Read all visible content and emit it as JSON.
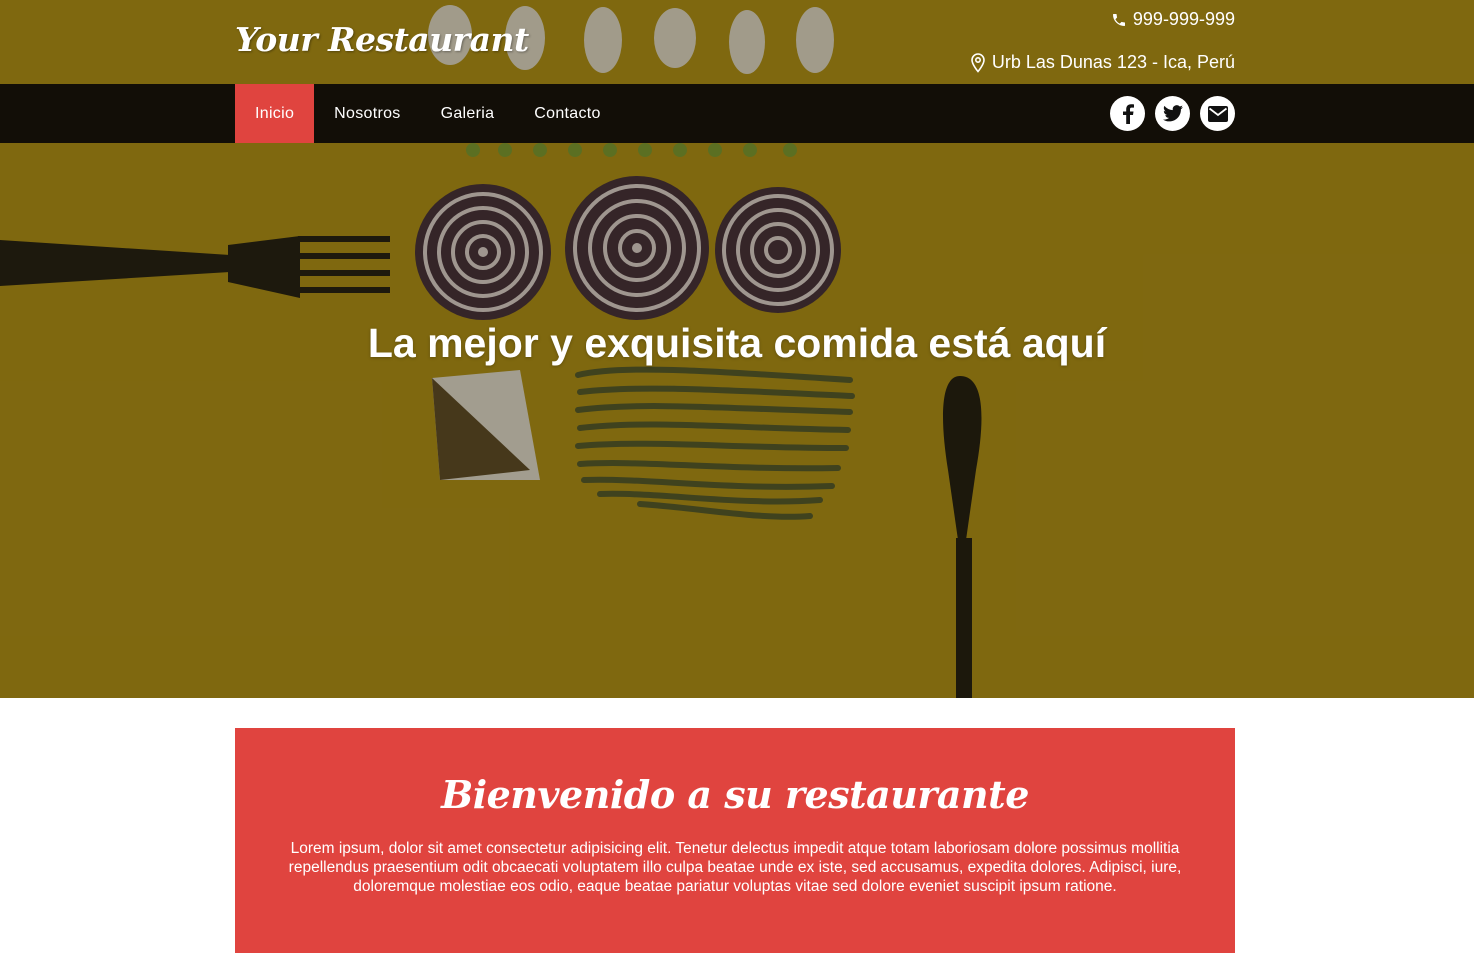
{
  "brand": {
    "name": "Your Restaurant"
  },
  "contact": {
    "phone": "999-999-999",
    "address": "Urb Las Dunas 123 - Ica, Perú"
  },
  "nav": {
    "items": [
      {
        "label": "Inicio",
        "active": true
      },
      {
        "label": "Nosotros",
        "active": false
      },
      {
        "label": "Galeria",
        "active": false
      },
      {
        "label": "Contacto",
        "active": false
      }
    ]
  },
  "social": [
    {
      "icon": "facebook-icon"
    },
    {
      "icon": "twitter-icon"
    },
    {
      "icon": "envelope-icon"
    }
  ],
  "hero": {
    "headline": "La mejor y exquisita comida está aquí"
  },
  "welcome": {
    "title": "Bienvenido a su restaurante",
    "text": "Lorem ipsum, dolor sit amet consectetur adipisicing elit. Tenetur delectus impedit atque totam laboriosam dolore possimus mollitia repellendus praesentium odit obcaecati voluptatem illo culpa beatae unde ex iste, sed accusamus, expedita dolores. Adipisci, iure, doloremque molestiae eos odio, eaque beatae pariatur voluptas vitae sed dolore eveniet suscipit ipsum ratione."
  },
  "colors": {
    "accent": "#e0443f",
    "nav_background": "#0a0806",
    "hero_background": "#b99a1a",
    "text_light": "#ffffff"
  }
}
